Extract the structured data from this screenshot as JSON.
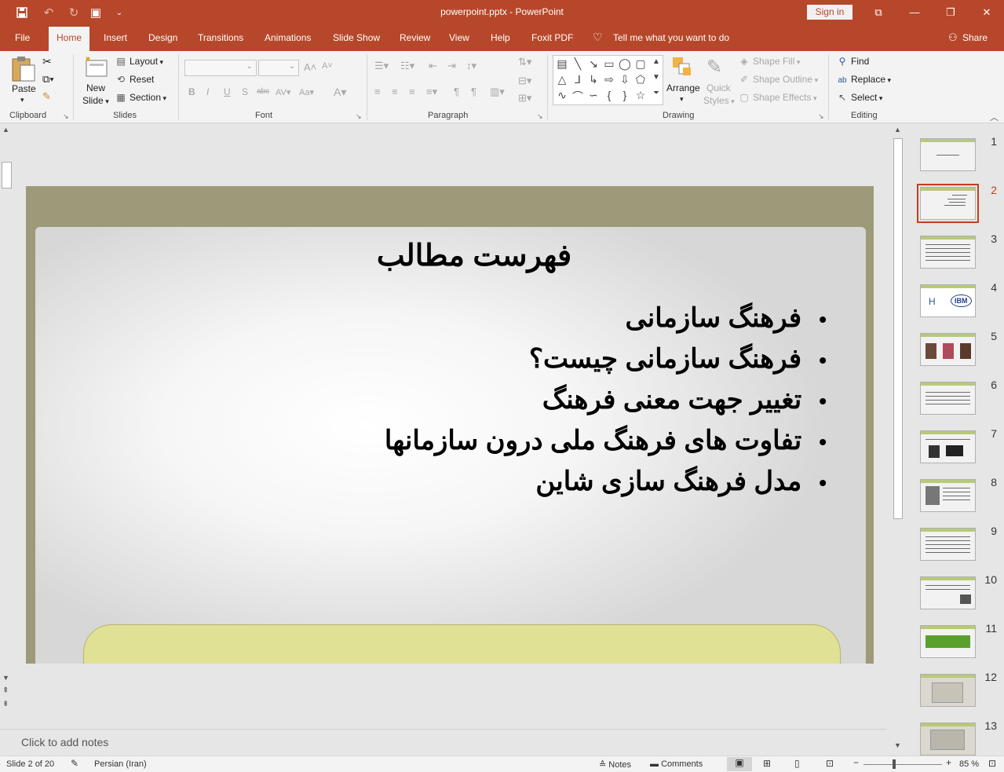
{
  "window": {
    "doc_title": "powerpoint.pptx  -  PowerPoint",
    "sign_in": "Sign in",
    "icons": [
      "save-icon",
      "undo-icon",
      "redo-icon",
      "present-icon",
      "customize-icon",
      "restore-icon",
      "minimize-icon",
      "maximize-icon",
      "close-icon"
    ]
  },
  "tabs": [
    "File",
    "Home",
    "Insert",
    "Design",
    "Transitions",
    "Animations",
    "Slide Show",
    "Review",
    "View",
    "Help",
    "Foxit PDF"
  ],
  "active_tab": "Home",
  "tell_me": "Tell me what you want to do",
  "share": "Share",
  "ribbon": {
    "clipboard": {
      "label": "Clipboard",
      "paste": "Paste"
    },
    "slides": {
      "label": "Slides",
      "new_slide": "New",
      "new_slide2": "Slide",
      "layout": "Layout",
      "reset": "Reset",
      "section": "Section"
    },
    "font": {
      "label": "Font"
    },
    "paragraph": {
      "label": "Paragraph"
    },
    "drawing": {
      "label": "Drawing",
      "arrange": "Arrange",
      "quick_styles": "Quick",
      "quick_styles2": "Styles",
      "shape_fill": "Shape Fill",
      "shape_outline": "Shape Outline",
      "shape_effects": "Shape Effects"
    },
    "editing": {
      "label": "Editing",
      "find": "Find",
      "replace": "Replace",
      "select": "Select"
    }
  },
  "slide": {
    "title": "فهرست مطالب",
    "bullets": [
      "فرهنگ سازمانی",
      "فرهنگ سازمانی چیست؟",
      "تغییر جهت معنی فرهنگ",
      "تفاوت های فرهنگ ملی درون سازمانها",
      "مدل فرهنگ سازی شاین"
    ]
  },
  "notes_placeholder": "Click to add notes",
  "thumbnails": [
    "1",
    "2",
    "3",
    "4",
    "5",
    "6",
    "7",
    "8",
    "9",
    "10",
    "11",
    "12",
    "13"
  ],
  "selected_slide": "2",
  "status": {
    "slide_info": "Slide 2 of 20",
    "language": "Persian (Iran)",
    "notes": "Notes",
    "comments": "Comments",
    "zoom": "85 %"
  },
  "colors": {
    "accent": "#b7472a",
    "slide_frame": "#9c9a78",
    "tab_shape": "#e0e194"
  }
}
